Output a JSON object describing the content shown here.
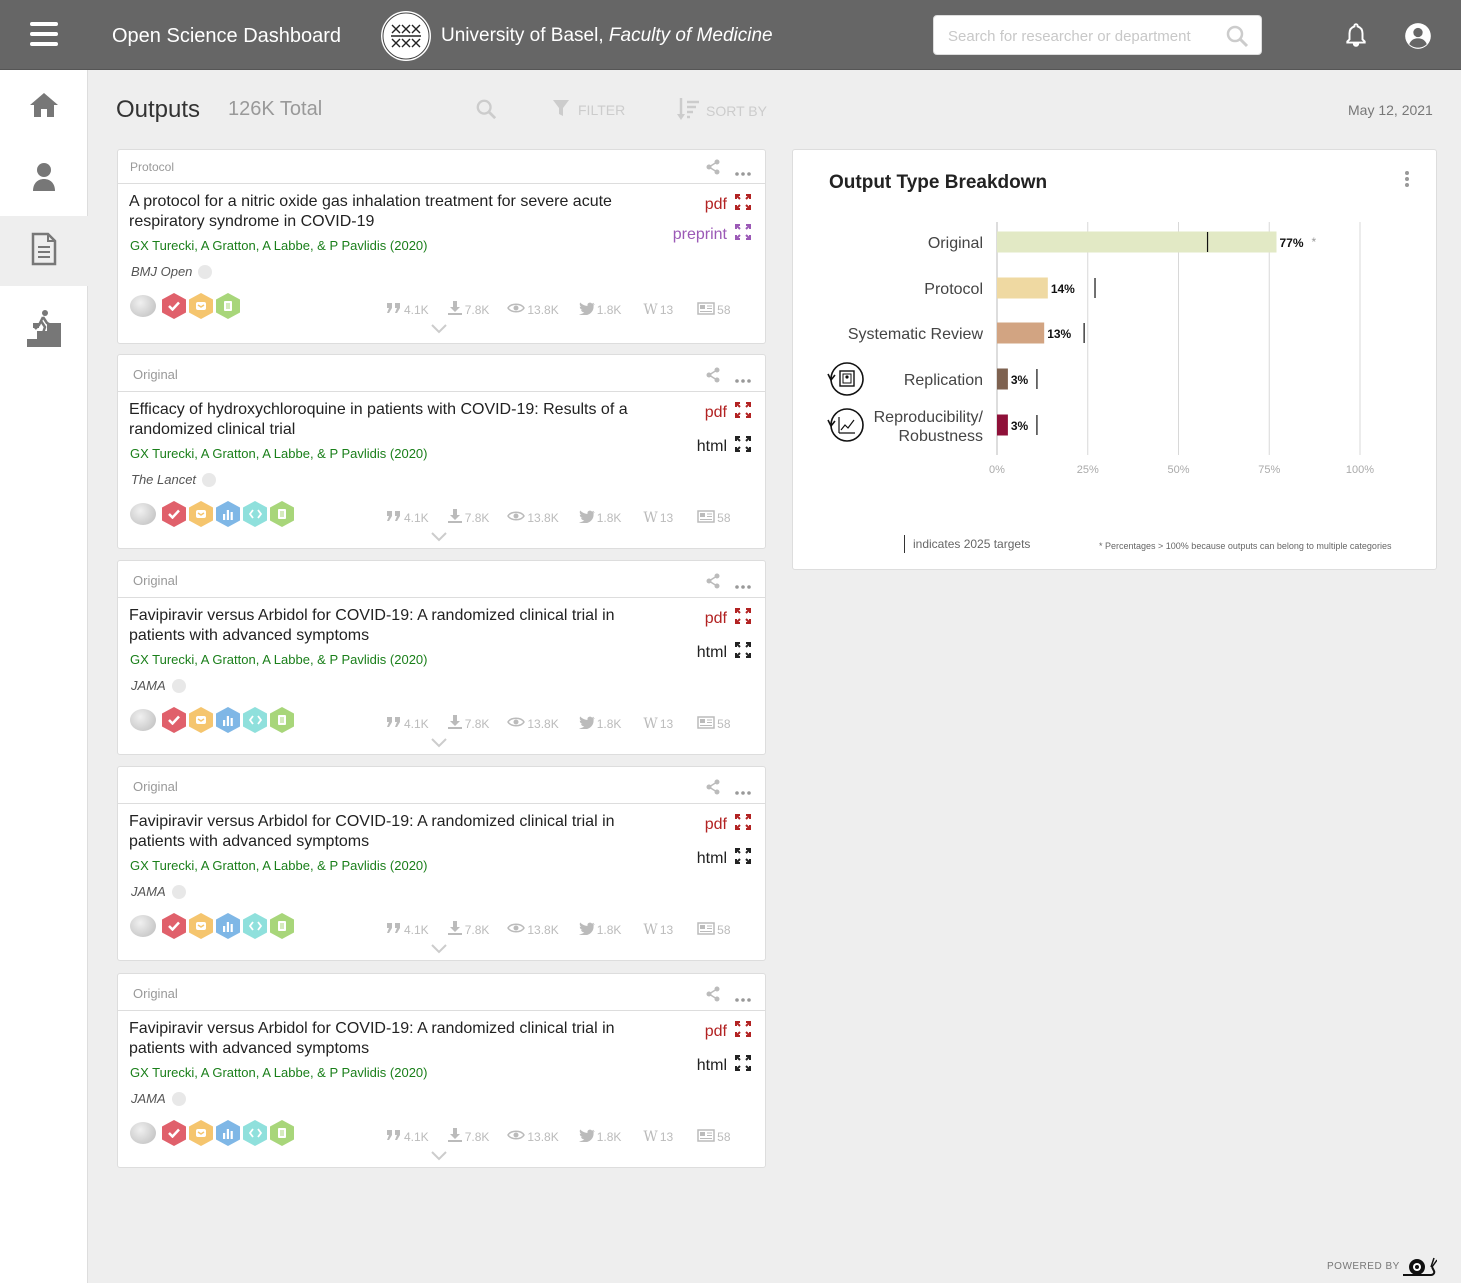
{
  "header": {
    "app_title": "Open Science Dashboard",
    "university": "University of Basel,",
    "faculty": "Faculty of Medicine",
    "search_placeholder": "Search for researcher or department"
  },
  "toolbar": {
    "title": "Outputs",
    "total": "126K Total",
    "filter_label": "FILTER",
    "sort_label": "SORT BY",
    "date": "May 12, 2021"
  },
  "cards": [
    {
      "type": "Protocol",
      "title": "A protocol for a nitric oxide gas inhalation treatment for severe acute respiratory syndrome in COVID-19",
      "authors": "GX Turecki, A Gratton, A Labbe, & P Pavlidis (2020)",
      "journal": "BMJ Open",
      "links": [
        "pdf",
        "preprint"
      ],
      "metrics": {
        "citations": "4.1K",
        "downloads": "7.8K",
        "views": "13.8K",
        "tweets": "1.8K",
        "wiki": "13",
        "news": "58"
      }
    },
    {
      "type": "Original",
      "title": "Efficacy of hydroxychloroquine in patients with COVID-19: Results of a randomized clinical trial",
      "authors": "GX Turecki, A Gratton, A Labbe, & P Pavlidis (2020)",
      "journal": "The Lancet",
      "links": [
        "pdf",
        "html"
      ],
      "metrics": {
        "citations": "4.1K",
        "downloads": "7.8K",
        "views": "13.8K",
        "tweets": "1.8K",
        "wiki": "13",
        "news": "58"
      }
    },
    {
      "type": "Original",
      "title": "Favipiravir versus Arbidol for COVID-19: A randomized clinical trial in patients with advanced symptoms",
      "authors": "GX Turecki, A Gratton, A Labbe, & P Pavlidis (2020)",
      "journal": "JAMA",
      "links": [
        "pdf",
        "html"
      ],
      "metrics": {
        "citations": "4.1K",
        "downloads": "7.8K",
        "views": "13.8K",
        "tweets": "1.8K",
        "wiki": "13",
        "news": "58"
      }
    },
    {
      "type": "Original",
      "title": "Favipiravir versus Arbidol for COVID-19: A randomized clinical trial in patients with advanced symptoms",
      "authors": "GX Turecki, A Gratton, A Labbe, & P Pavlidis (2020)",
      "journal": "JAMA",
      "links": [
        "pdf",
        "html"
      ],
      "metrics": {
        "citations": "4.1K",
        "downloads": "7.8K",
        "views": "13.8K",
        "tweets": "1.8K",
        "wiki": "13",
        "news": "58"
      }
    },
    {
      "type": "Original",
      "title": "Favipiravir versus Arbidol for COVID-19: A randomized clinical trial in patients with advanced symptoms",
      "authors": "GX Turecki, A Gratton, A Labbe, & P Pavlidis (2020)",
      "journal": "JAMA",
      "links": [
        "pdf",
        "html"
      ],
      "metrics": {
        "citations": "4.1K",
        "downloads": "7.8K",
        "views": "13.8K",
        "tweets": "1.8K",
        "wiki": "13",
        "news": "58"
      }
    }
  ],
  "chart_panel": {
    "title": "Output Type Breakdown",
    "legend_text": "indicates 2025 targets",
    "footnote": "* Percentages > 100% because outputs can belong to multiple categories"
  },
  "chart_data": {
    "type": "bar",
    "orientation": "horizontal",
    "categories": [
      "Original",
      "Protocol",
      "Systematic Review",
      "Replication",
      "Reproducibility/ Robustness"
    ],
    "values": [
      77,
      14,
      13,
      3,
      3
    ],
    "value_labels": [
      "77%",
      "14%",
      "13%",
      "3%",
      "3%"
    ],
    "targets": [
      58,
      27,
      24,
      11,
      11
    ],
    "colors": [
      "#e2e9c5",
      "#efd9a2",
      "#d2a482",
      "#7e6250",
      "#8e1038"
    ],
    "xticks": [
      "0%",
      "25%",
      "50%",
      "75%",
      "100%"
    ],
    "xlim": [
      0,
      100
    ],
    "asterisk": "*",
    "grid": true
  },
  "footer": {
    "powered_by": "POWERED BY"
  },
  "colors": {
    "topbar": "#666666",
    "authors": "#1a7f1a",
    "pdf": "#b22222",
    "preprint": "#9b59b6",
    "badge_red": "#e0606b",
    "badge_yellow": "#f5c56e",
    "badge_blue": "#7fb7e6",
    "badge_teal": "#8fe0dc",
    "badge_green": "#a8d67a"
  }
}
